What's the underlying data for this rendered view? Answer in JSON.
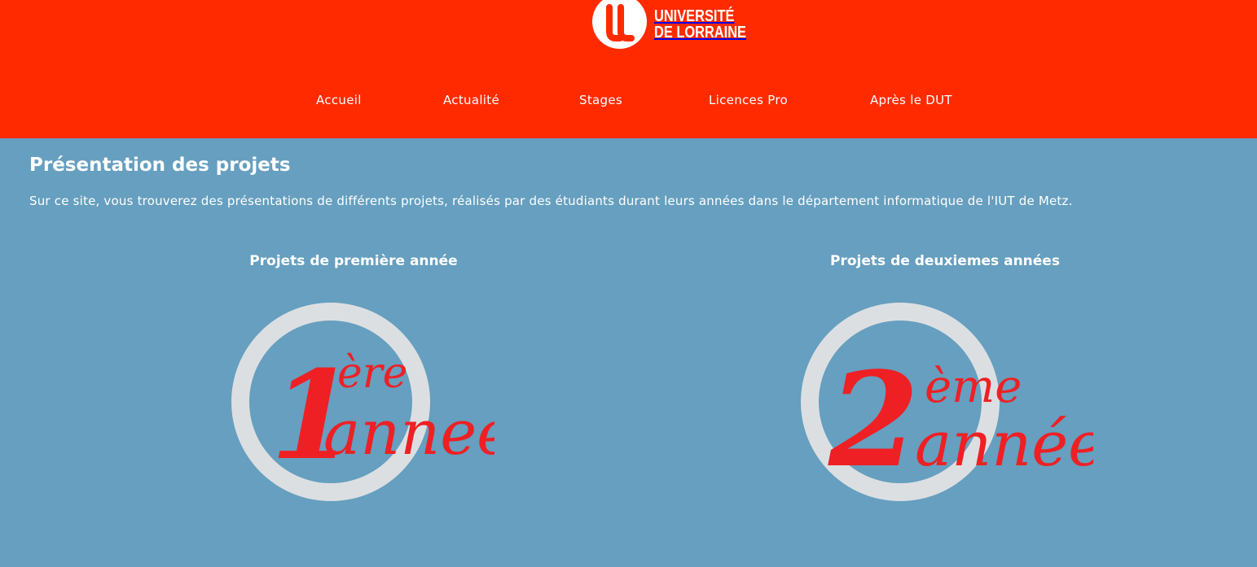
{
  "header": {
    "logo": {
      "icon": "universite-de-lorraine-logo",
      "line1": "UNIVERSITÉ",
      "line2": "DE LORRAINE"
    },
    "background_color": "#ff2a00"
  },
  "nav": {
    "items": [
      {
        "label": "Accueil"
      },
      {
        "label": "Actualité"
      },
      {
        "label": "Stages"
      },
      {
        "label": "Licences Pro"
      },
      {
        "label": "Après le DUT"
      }
    ]
  },
  "main": {
    "background_color": "#669fbf",
    "title": "Présentation des projets",
    "intro": "Sur ce site, vous trouverez des présentations de différents projets, réalisés par des étudiants durant leurs années dans le département informatique de l'IUT de Metz.",
    "sections": [
      {
        "title": "Projets de première année",
        "badge": {
          "number": "1",
          "superscript": "ère",
          "word": "annee"
        }
      },
      {
        "title": "Projets de deuxiemes années",
        "badge": {
          "number": "2",
          "superscript": "ème",
          "word": "année"
        }
      }
    ]
  }
}
